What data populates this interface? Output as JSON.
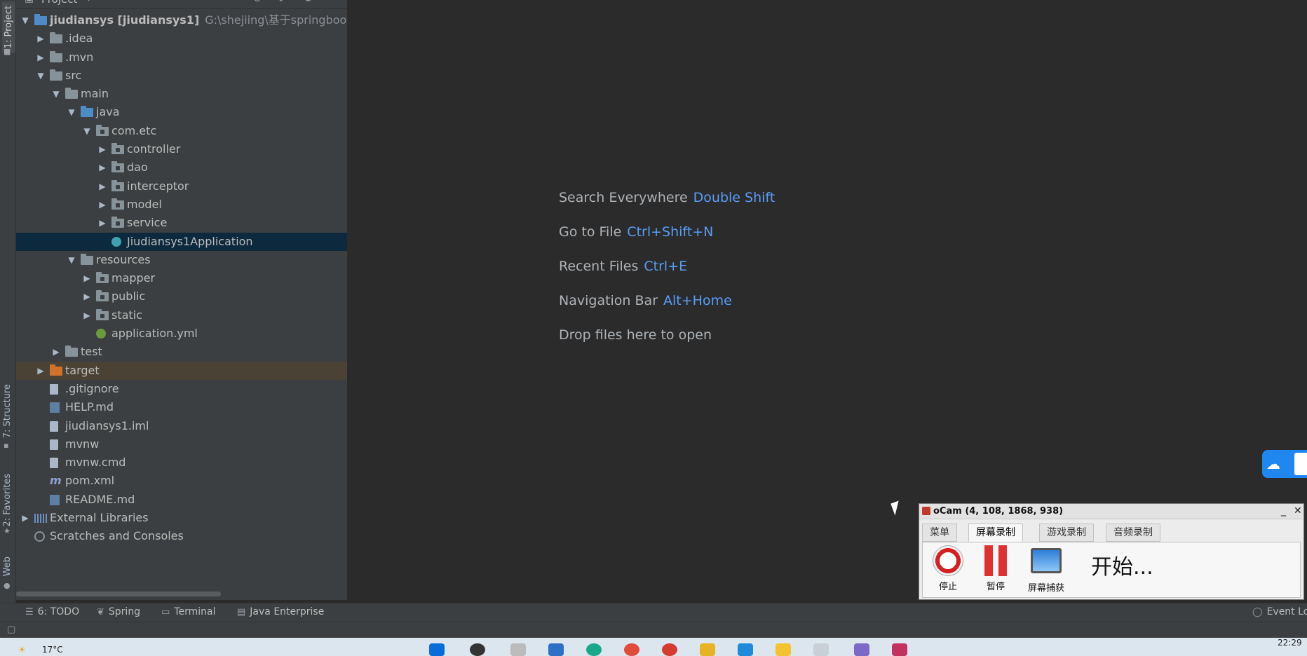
{
  "left_strip": {
    "project_tab": "1: Project",
    "structure_tab": "7: Structure",
    "favorites_tab": "2: Favorites",
    "web_tab": "Web"
  },
  "project_pane": {
    "title": "Project",
    "tree": [
      {
        "label": "jiudiansys [jiudiansys1]",
        "path": "G:\\shejiing\\基于springboot vue.js流",
        "indent": 0,
        "arrow": "▼",
        "icon": "module"
      },
      {
        "label": ".idea",
        "indent": 1,
        "arrow": "▶",
        "icon": "folder"
      },
      {
        "label": ".mvn",
        "indent": 1,
        "arrow": "▶",
        "icon": "folder"
      },
      {
        "label": "src",
        "indent": 1,
        "arrow": "▼",
        "icon": "folder"
      },
      {
        "label": "main",
        "indent": 2,
        "arrow": "▼",
        "icon": "folder"
      },
      {
        "label": "java",
        "indent": 3,
        "arrow": "▼",
        "icon": "folder-blue"
      },
      {
        "label": "com.etc",
        "indent": 4,
        "arrow": "▼",
        "icon": "package"
      },
      {
        "label": "controller",
        "indent": 5,
        "arrow": "▶",
        "icon": "package"
      },
      {
        "label": "dao",
        "indent": 5,
        "arrow": "▶",
        "icon": "package"
      },
      {
        "label": "interceptor",
        "indent": 5,
        "arrow": "▶",
        "icon": "package"
      },
      {
        "label": "model",
        "indent": 5,
        "arrow": "▶",
        "icon": "package"
      },
      {
        "label": "service",
        "indent": 5,
        "arrow": "▶",
        "icon": "package"
      },
      {
        "label": "Jiudiansys1Application",
        "indent": 5,
        "arrow": "",
        "icon": "java-class",
        "selected": true
      },
      {
        "label": "resources",
        "indent": 3,
        "arrow": "▼",
        "icon": "resources"
      },
      {
        "label": "mapper",
        "indent": 4,
        "arrow": "▶",
        "icon": "package"
      },
      {
        "label": "public",
        "indent": 4,
        "arrow": "▶",
        "icon": "package"
      },
      {
        "label": "static",
        "indent": 4,
        "arrow": "▶",
        "icon": "package"
      },
      {
        "label": "application.yml",
        "indent": 4,
        "arrow": "",
        "icon": "spring-config"
      },
      {
        "label": "test",
        "indent": 2,
        "arrow": "▶",
        "icon": "folder"
      },
      {
        "label": "target",
        "indent": 1,
        "arrow": "▶",
        "icon": "folder-orange",
        "highlight": true
      },
      {
        "label": ".gitignore",
        "indent": 1,
        "arrow": "",
        "icon": "file"
      },
      {
        "label": "HELP.md",
        "indent": 1,
        "arrow": "",
        "icon": "md-file"
      },
      {
        "label": "jiudiansys1.iml",
        "indent": 1,
        "arrow": "",
        "icon": "file"
      },
      {
        "label": "mvnw",
        "indent": 1,
        "arrow": "",
        "icon": "file"
      },
      {
        "label": "mvnw.cmd",
        "indent": 1,
        "arrow": "",
        "icon": "file"
      },
      {
        "label": "pom.xml",
        "indent": 1,
        "arrow": "",
        "icon": "maven"
      },
      {
        "label": "README.md",
        "indent": 1,
        "arrow": "",
        "icon": "md-file"
      },
      {
        "label": "External Libraries",
        "indent": 0,
        "arrow": "▶",
        "icon": "libraries"
      },
      {
        "label": "Scratches and Consoles",
        "indent": 0,
        "arrow": "",
        "icon": "scratches"
      }
    ]
  },
  "editor": {
    "hints": [
      {
        "label": "Search Everywhere",
        "key": "Double Shift"
      },
      {
        "label": "Go to File",
        "key": "Ctrl+Shift+N"
      },
      {
        "label": "Recent Files",
        "key": "Ctrl+E"
      },
      {
        "label": "Navigation Bar",
        "key": "Alt+Home"
      },
      {
        "label": "Drop files here to open",
        "key": ""
      }
    ]
  },
  "bottom_tools": {
    "todo": "6: TODO",
    "spring": "Spring",
    "terminal": "Terminal",
    "java_enterprise": "Java Enterprise",
    "event_log": "Event Lo"
  },
  "ocam": {
    "title": "oCam (4, 108, 1868, 938)",
    "tabs": [
      "菜单",
      "屏幕录制",
      "游戏录制",
      "音频录制"
    ],
    "active_tab": "屏幕录制",
    "buttons": {
      "stop": "停止",
      "pause": "暂停",
      "capture": "屏幕捕获"
    },
    "status": "开始..."
  },
  "taskbar": {
    "weather": "17°C",
    "time": "22:29"
  }
}
